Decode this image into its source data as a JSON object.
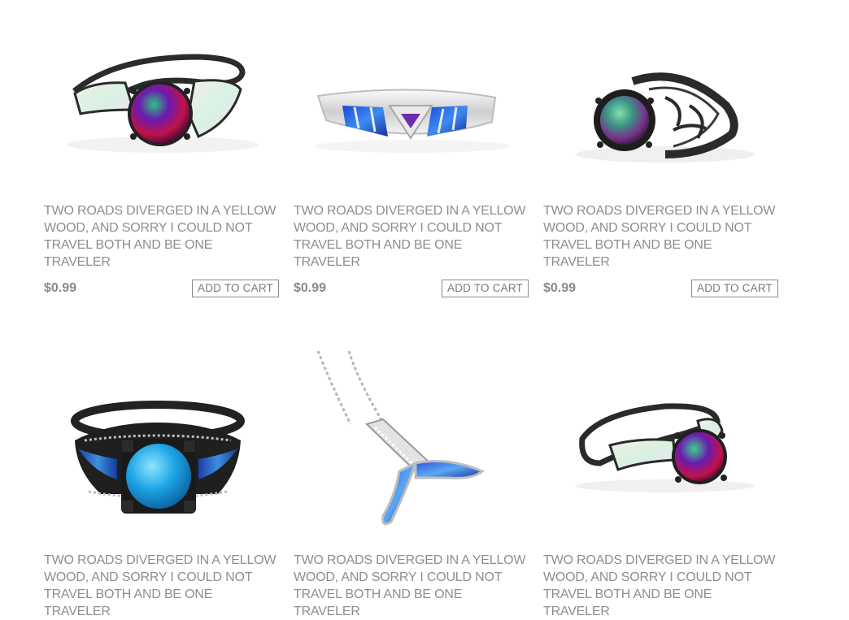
{
  "products": [
    {
      "title": "TWO ROADS DIVERGED IN A YELLOW WOOD, AND SORRY I COULD NOT TRAVEL BOTH AND BE ONE TRAVELER",
      "price": "$0.99",
      "cart_label": "ADD TO CART",
      "image": "black-opal-ring-rainbow-stone"
    },
    {
      "title": "TWO ROADS DIVERGED IN A YELLOW WOOD, AND SORRY I COULD NOT TRAVEL BOTH AND BE ONE TRAVELER",
      "price": "$0.99",
      "cart_label": "ADD TO CART",
      "image": "silver-blue-opal-bangle"
    },
    {
      "title": "TWO ROADS DIVERGED IN A YELLOW WOOD, AND SORRY I COULD NOT TRAVEL BOTH AND BE ONE TRAVELER",
      "price": "$0.99",
      "cart_label": "ADD TO CART",
      "image": "black-filigree-ring-mystic-stone"
    },
    {
      "title": "TWO ROADS DIVERGED IN A YELLOW WOOD, AND SORRY I COULD NOT TRAVEL BOTH AND BE ONE TRAVELER",
      "price": "",
      "cart_label": "",
      "image": "black-ring-blue-topaz-opal-band"
    },
    {
      "title": "TWO ROADS DIVERGED IN A YELLOW WOOD, AND SORRY I COULD NOT TRAVEL BOTH AND BE ONE TRAVELER",
      "price": "",
      "cart_label": "",
      "image": "silver-whale-tail-opal-necklace"
    },
    {
      "title": "TWO ROADS DIVERGED IN A YELLOW WOOD, AND SORRY I COULD NOT TRAVEL BOTH AND BE ONE TRAVELER",
      "price": "",
      "cart_label": "",
      "image": "black-opal-ring-mystic-stone"
    }
  ],
  "colors": {
    "text": "#8e8e8e",
    "border": "#8a8a8a",
    "background": "#ffffff"
  }
}
